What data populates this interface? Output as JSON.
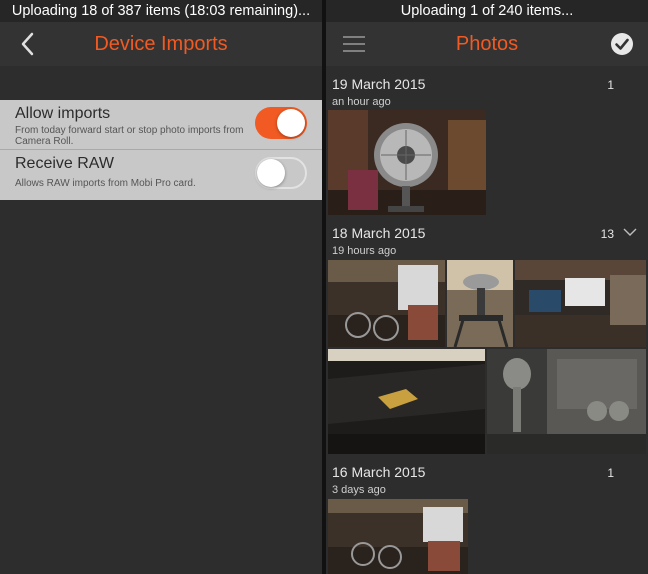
{
  "left": {
    "status_text": "Uploading 18 of 387 items (18:03 remaining)...",
    "nav_title": "Device Imports",
    "settings": [
      {
        "label": "Allow imports",
        "description": "From today forward start or stop photo imports from Camera Roll.",
        "enabled": true
      },
      {
        "label": "Receive RAW",
        "description": "Allows RAW imports from Mobi Pro card.",
        "enabled": false
      }
    ]
  },
  "right": {
    "status_text": "Uploading 1 of 240 items...",
    "nav_title": "Photos",
    "sections": [
      {
        "date": "19 March 2015",
        "ago": "an hour ago",
        "count": "1"
      },
      {
        "date": "18 March 2015",
        "ago": "19 hours ago",
        "count": "13"
      },
      {
        "date": "16 March 2015",
        "ago": "3 days ago",
        "count": "1"
      }
    ]
  },
  "colors": {
    "accent": "#f15a22",
    "background": "#2d2d2d",
    "settings_bg": "#c8c8c8"
  },
  "icons": {
    "back": "chevron-left-icon",
    "menu": "hamburger-menu-icon",
    "select": "checkmark-circle-icon",
    "expand": "chevron-down-icon"
  }
}
